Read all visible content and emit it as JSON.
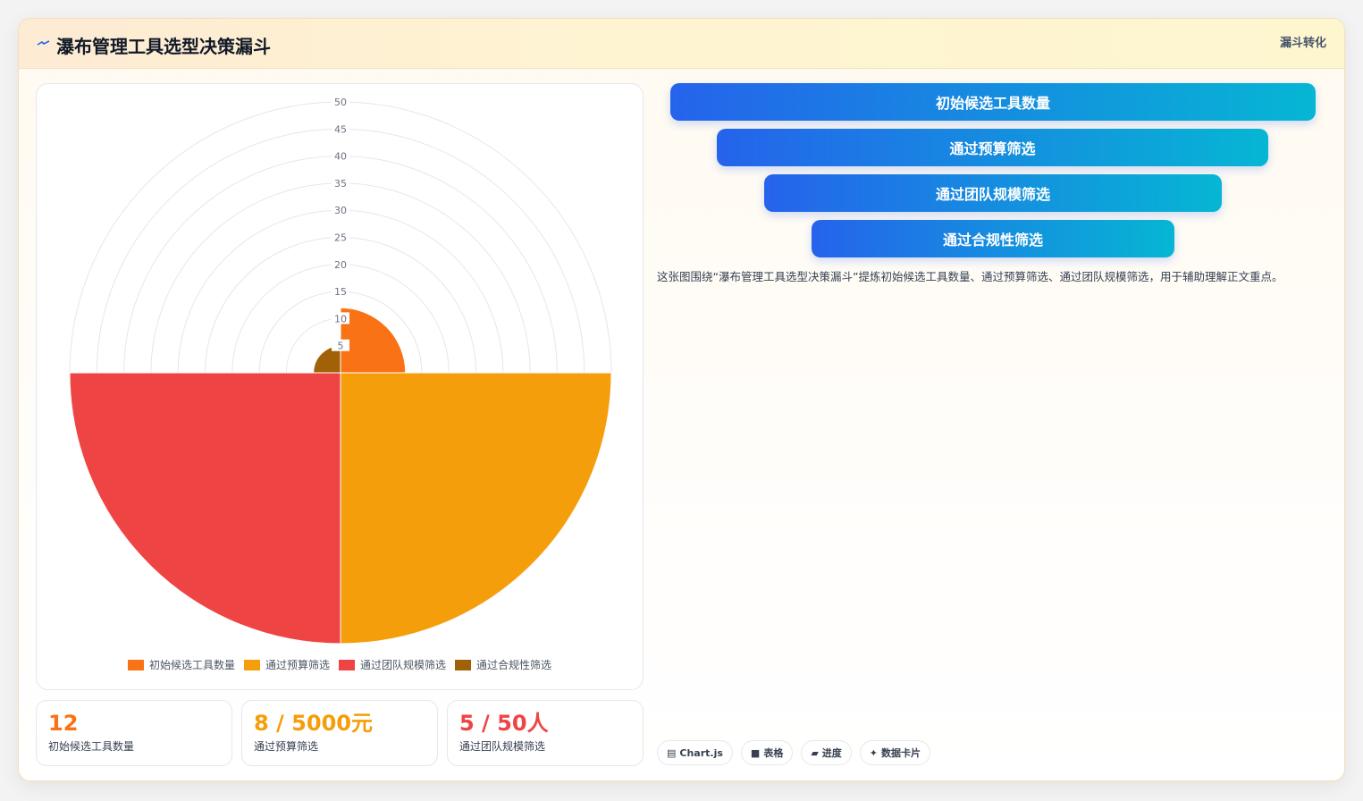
{
  "header": {
    "title": "瀑布管理工具选型决策漏斗",
    "tag": "漏斗转化",
    "icon": "lightning-icon"
  },
  "chart_data": {
    "type": "polarArea",
    "categories": [
      "初始候选工具数量",
      "通过预算筛选",
      "通过团队规模筛选",
      "通过合规性筛选"
    ],
    "values": [
      12,
      50,
      50,
      5
    ],
    "colors": [
      "#f97316",
      "#f59e0b",
      "#ef4444",
      "#a16207"
    ],
    "r_ticks": [
      5,
      10,
      15,
      20,
      25,
      30,
      35,
      40,
      45,
      50
    ],
    "rlim": [
      0,
      50
    ],
    "grid": true,
    "legend_position": "bottom"
  },
  "stats": [
    {
      "value": "12",
      "label": "初始候选工具数量",
      "color": "#f97316"
    },
    {
      "value": "8 / 5000元",
      "label": "通过预算筛选",
      "color": "#f59e0b"
    },
    {
      "value": "5 / 50人",
      "label": "通过团队规模筛选",
      "color": "#ef4444"
    }
  ],
  "funnel": [
    {
      "label": "初始候选工具数量"
    },
    {
      "label": "通过预算筛选"
    },
    {
      "label": "通过团队规模筛选"
    },
    {
      "label": "通过合规性筛选"
    }
  ],
  "description": "这张图围绕“瀑布管理工具选型决策漏斗”提炼初始候选工具数量、通过预算筛选、通过团队规模筛选，用于辅助理解正文重点。",
  "chips": [
    {
      "icon": "chart-icon",
      "glyph": "▤",
      "label": "Chart.js"
    },
    {
      "icon": "table-icon",
      "glyph": "■",
      "label": "表格"
    },
    {
      "icon": "progress-icon",
      "glyph": "▰",
      "label": "进度"
    },
    {
      "icon": "sparkle-icon",
      "glyph": "✦",
      "label": "数据卡片"
    }
  ]
}
